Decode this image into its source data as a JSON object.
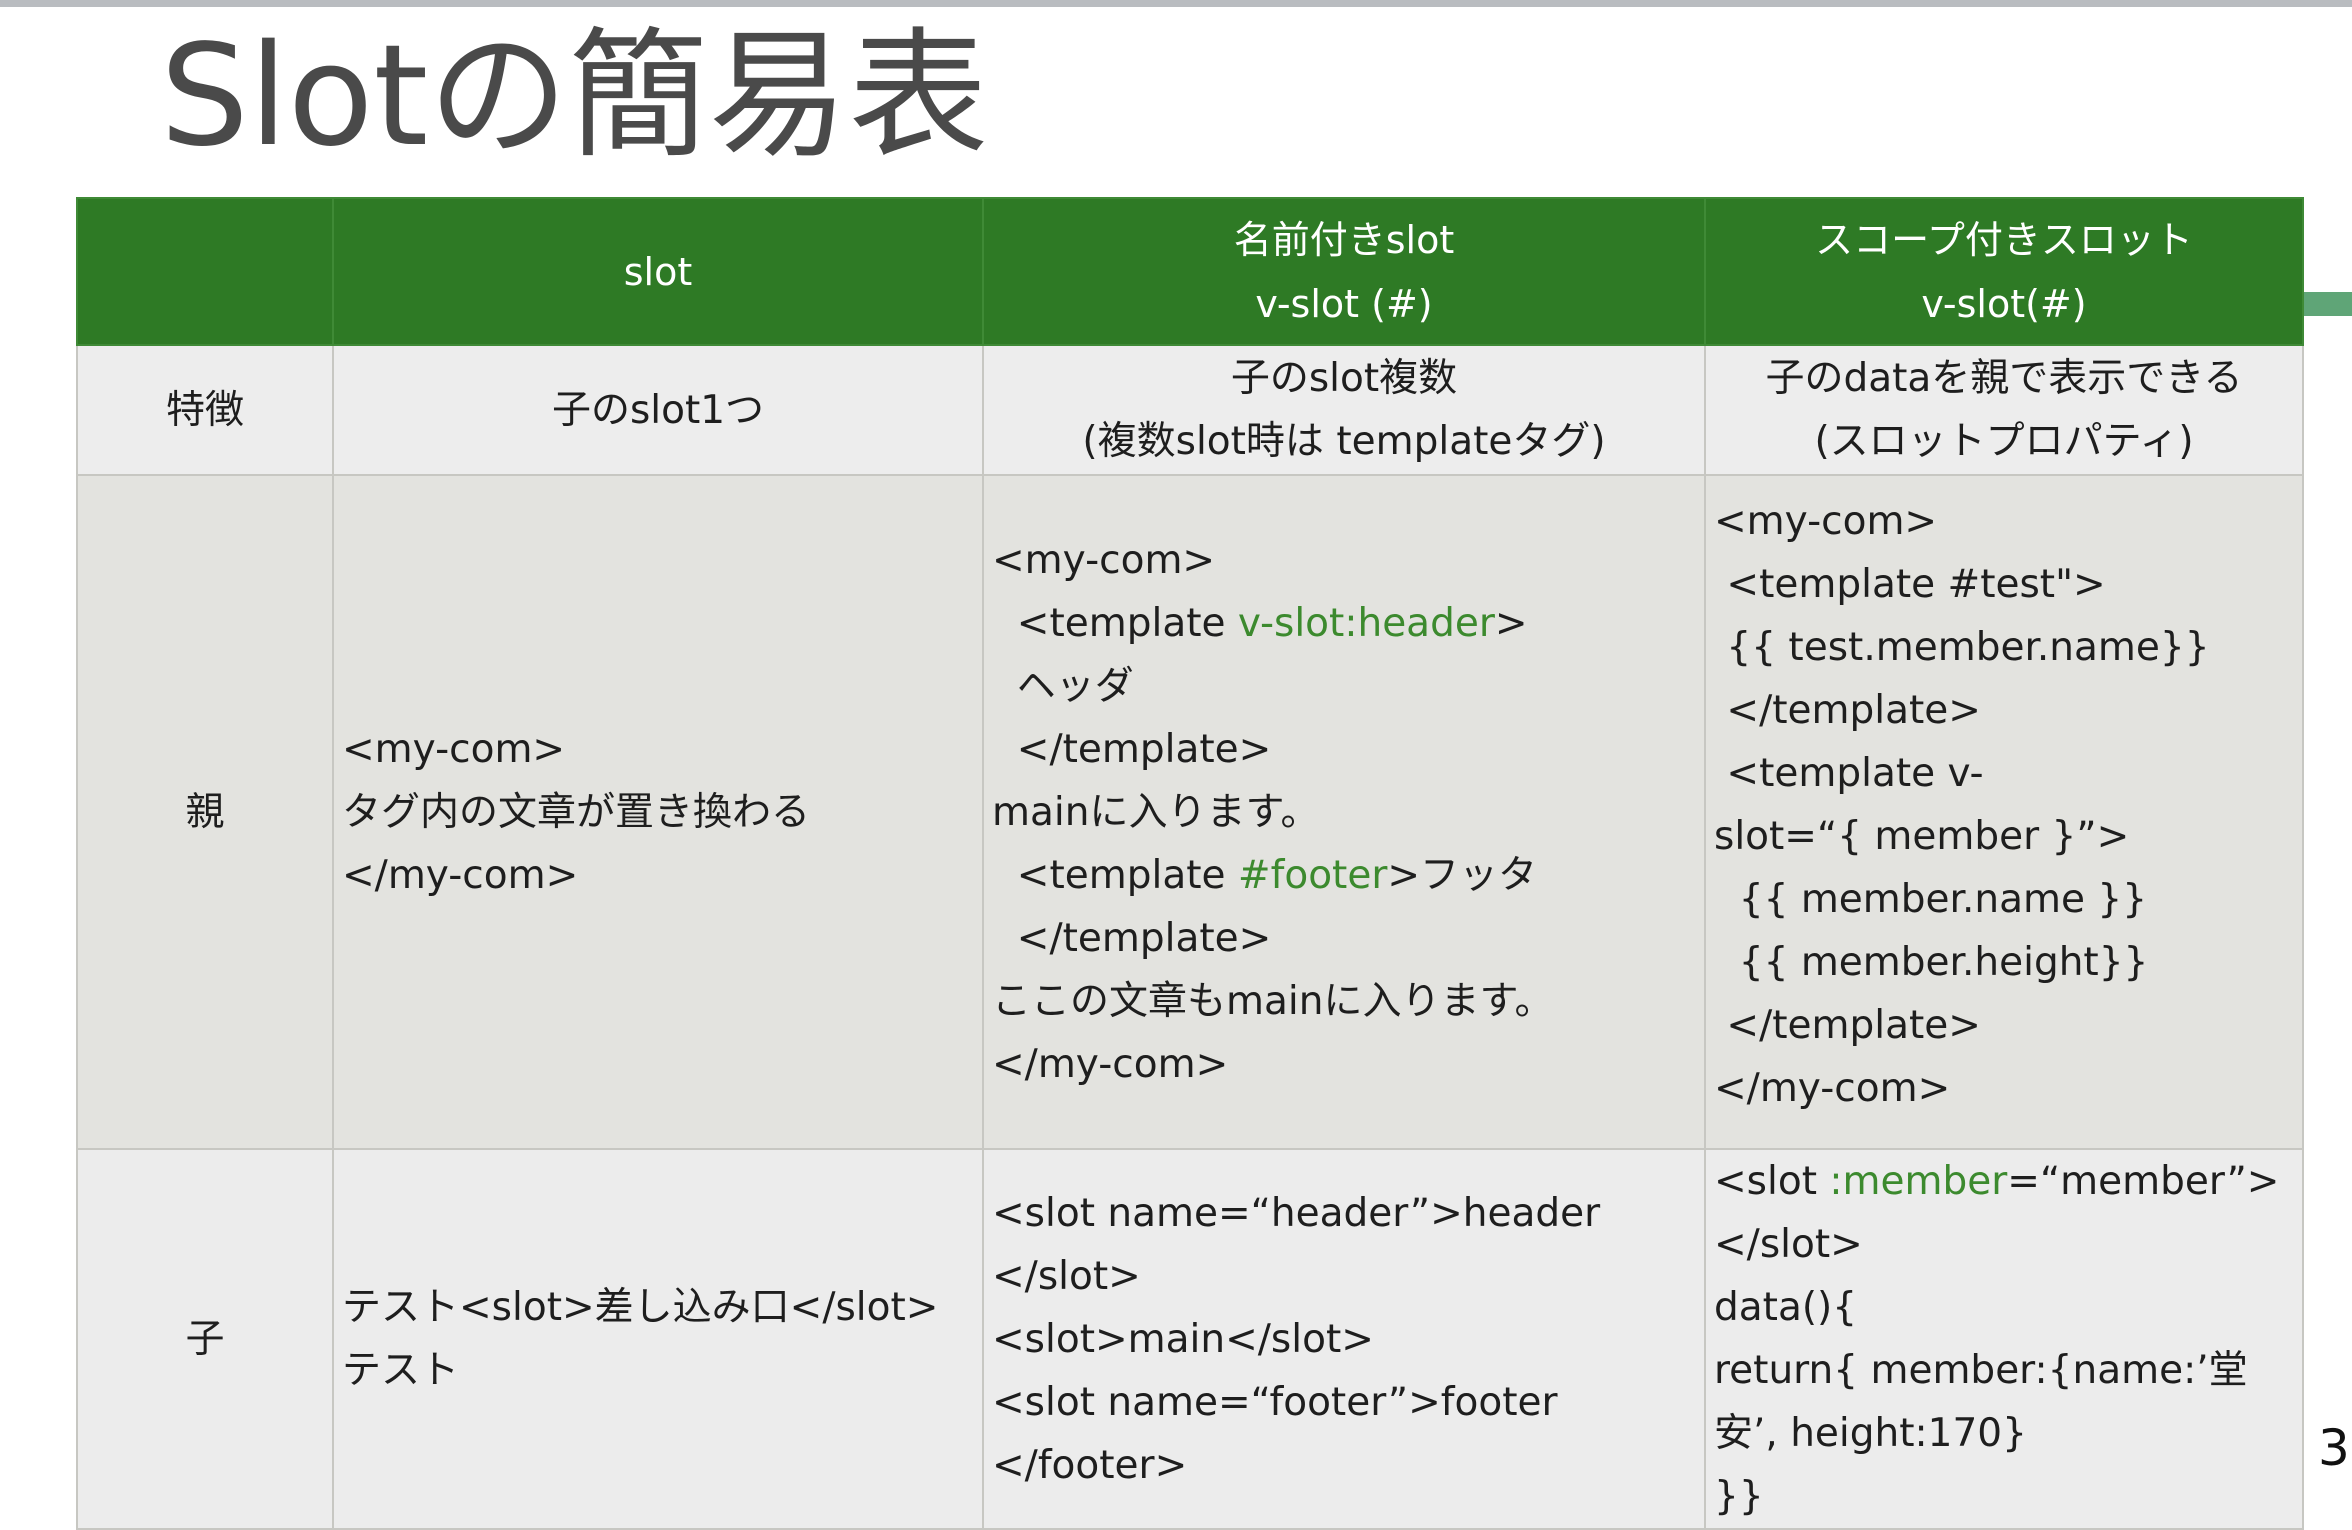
{
  "slide": {
    "title": "Slotの簡易表",
    "page_number": "3"
  },
  "table": {
    "header": {
      "corner": "",
      "slot": "slot",
      "named_line1": "名前付きslot",
      "named_line2": "v-slot (#)",
      "scoped_line1": "スコープ付きスロット",
      "scoped_line2": "v-slot(#)"
    },
    "feature": {
      "label": "特徴",
      "slot": "子のslot1つ",
      "named_line1": "子のslot複数",
      "named_line2": "(複数slot時は templateタグ)",
      "scoped_line1": "子のdataを親で表示できる",
      "scoped_line2": "(スロットプロパティ)"
    },
    "parent": {
      "label": "親",
      "slot": {
        "l1": "<my-com>",
        "l2": "タグ内の文章が置き換わる",
        "l3": "</my-com>"
      },
      "named": {
        "l1": "<my-com>",
        "l2_a": "  <template ",
        "l2_hl": "v-slot:header",
        "l2_b": ">",
        "l3": "  ヘッダ",
        "l4": "  </template>",
        "l5": "mainに入ります。",
        "l6_a": "  <template ",
        "l6_hl": "#footer",
        "l6_b": ">フッタ",
        "l7": "  </template>",
        "l8": "ここの文章もmainに入ります。",
        "l9": "</my-com>"
      },
      "scoped": {
        "l1": "<my-com>",
        "l2": " <template #test\">",
        "l3": " {{ test.member.name}}",
        "l4": " </template>",
        "l5": " <template v-",
        "l6": "slot=“{ member }”>",
        "l7": "  {{ member.name }}",
        "l8": "  {{ member.height}}",
        "l9": " </template>",
        "l10": "</my-com>"
      }
    },
    "child": {
      "label": "子",
      "slot": {
        "l1": "テスト<slot>差し込み口</slot>",
        "l2": "テスト"
      },
      "named": {
        "l1": "<slot name=“header”>header",
        "l2": "</slot>",
        "l3": "<slot>main</slot>",
        "l4": "<slot name=“footer”>footer",
        "l5": "</footer>"
      },
      "scoped": {
        "l1_a": "<slot ",
        "l1_hl": ":member",
        "l1_b": "=“member”>",
        "l2": "</slot>",
        "l3": "data(){",
        "l4": "return{ member:{name:’堂",
        "l5": "安’, height:170}",
        "l6": "}}"
      }
    }
  },
  "colors": {
    "header_green": "#2e7a25",
    "highlight_green": "#3c8a2e",
    "title_gray": "#4a4a4a"
  }
}
